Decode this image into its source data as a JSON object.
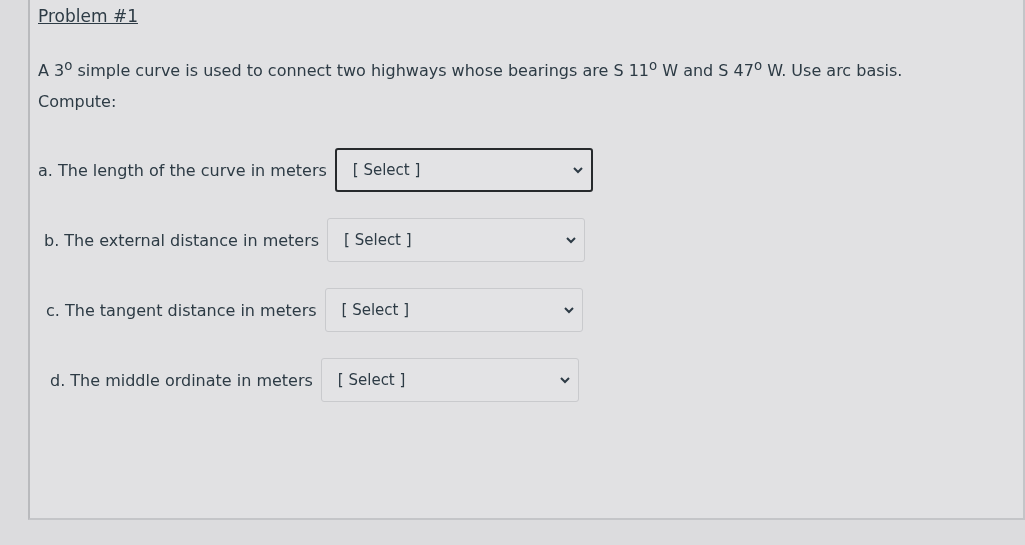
{
  "question": {
    "title": "Problem #1",
    "text": "A 3$^{o}$ simple curve is used to connect two highways whose bearings are S 11$^{o}$ W and S 47$^{o}$ W. Use arc basis.",
    "prompt": "Compute:",
    "items": [
      {
        "label": "a. The length of the curve in meters",
        "placeholder": "[ Select ]",
        "focused": true
      },
      {
        "label": "b. The external distance in meters",
        "placeholder": "[ Select ]",
        "focused": false
      },
      {
        "label": "c. The tangent distance in meters",
        "placeholder": "[ Select ]",
        "focused": false
      },
      {
        "label": "d. The middle ordinate in meters",
        "placeholder": "[ Select ]",
        "focused": false
      }
    ]
  }
}
